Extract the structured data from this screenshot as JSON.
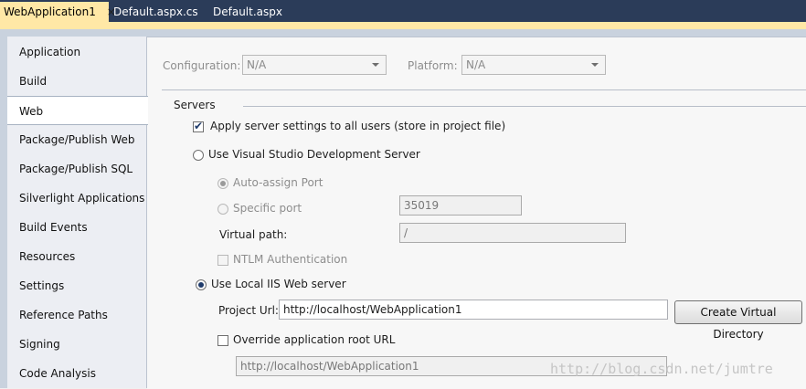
{
  "tabs": [
    {
      "label": "WebApplication1",
      "close": "×"
    },
    {
      "label": "Default.aspx.cs"
    },
    {
      "label": "Default.aspx"
    }
  ],
  "nav": {
    "items": [
      "Application",
      "Build",
      "Web",
      "Package/Publish Web",
      "Package/Publish SQL",
      "Silverlight Applications",
      "Build Events",
      "Resources",
      "Settings",
      "Reference Paths",
      "Signing",
      "Code Analysis"
    ],
    "selected": "Web"
  },
  "config": {
    "configuration_label": "Configuration:",
    "configuration_value": "N/A",
    "platform_label": "Platform:",
    "platform_value": "N/A"
  },
  "servers": {
    "heading": "Servers",
    "apply_settings_label": "Apply server settings to all users (store in project file)",
    "apply_settings_checked": true,
    "vs_dev_server_label": "Use Visual Studio Development Server",
    "auto_assign_port_label": "Auto-assign Port",
    "specific_port_label": "Specific port",
    "specific_port_value": "35019",
    "virtual_path_label": "Virtual path:",
    "virtual_path_value": "/",
    "ntlm_label": "NTLM Authentication",
    "local_iis_label": "Use Local IIS Web server",
    "project_url_label": "Project Url:",
    "project_url_value": "http://localhost/WebApplication1",
    "create_vdir_button": "Create Virtual Directory",
    "override_root_label": "Override application root URL",
    "override_root_value": "http://localhost/WebApplication1"
  },
  "watermark": "http://blog.csdn.net/jumtre",
  "colors": {
    "tab_strip": "#2b3c59",
    "active_tab": "#ffe8a6",
    "nav_background": "#eceef3",
    "content_background": "#f7f7f7"
  }
}
